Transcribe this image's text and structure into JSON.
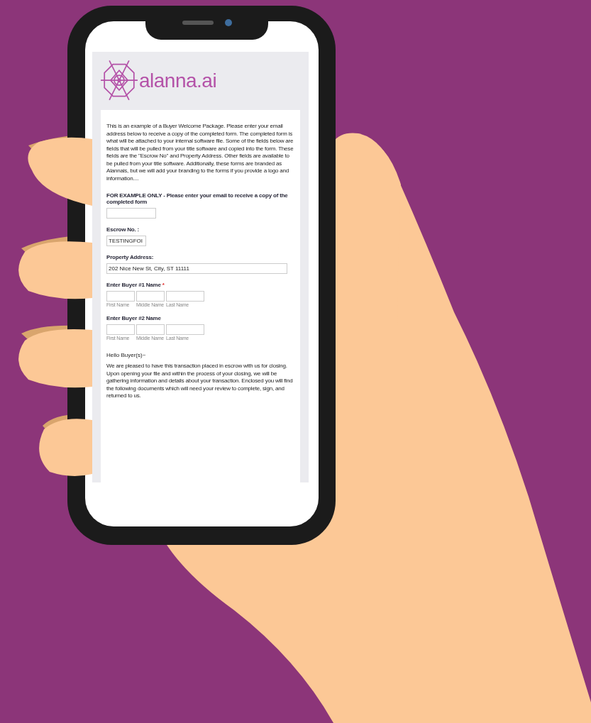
{
  "logo": {
    "text": "alanna.ai"
  },
  "intro": "This is an example of a Buyer Welcome Package.  Please enter your email address below to receive a copy of the completed form.  The completed form is what will be attached to your internal software file.  Some of the fields below are fields that will be pulled from your title software and copied into the form.  These fields are the \"Escrow No\" and Property Address.  Other fields are available to be pulled from your title software.  Additionally, these forms are branded as Alannais, but we will add your branding  to the forms if you provide a logo and information....",
  "fields": [
    {
      "kind": "email",
      "label": "FOR EXAMPLE ONLY - Please enter your email to receive a copy of the completed form"
    },
    {
      "kind": "code",
      "label": "Escrow No. :",
      "value": "TESTINGFOI"
    },
    {
      "kind": "address",
      "label": "Property Address:",
      "value": "202 Nice New St, City, ST 11111"
    },
    {
      "kind": "name",
      "label": "Enter Buyer #1 Name",
      "required_mark": "*",
      "sublabels": [
        "First Name",
        "Middle Name",
        "Last Name"
      ]
    },
    {
      "kind": "name",
      "label": "Enter Buyer #2 Name",
      "sublabels": [
        "First Name",
        "Middle Name",
        "Last Name"
      ]
    }
  ],
  "greeting": "Hello Buyer(s)~",
  "message": "We are pleased to have this transaction placed in escrow with us for closing. Upon opening your file and within the process of your closing, we will be gathering information and details about your transaction. Enclosed you will find the following documents which will need your review to complete, sign, and returned to us."
}
